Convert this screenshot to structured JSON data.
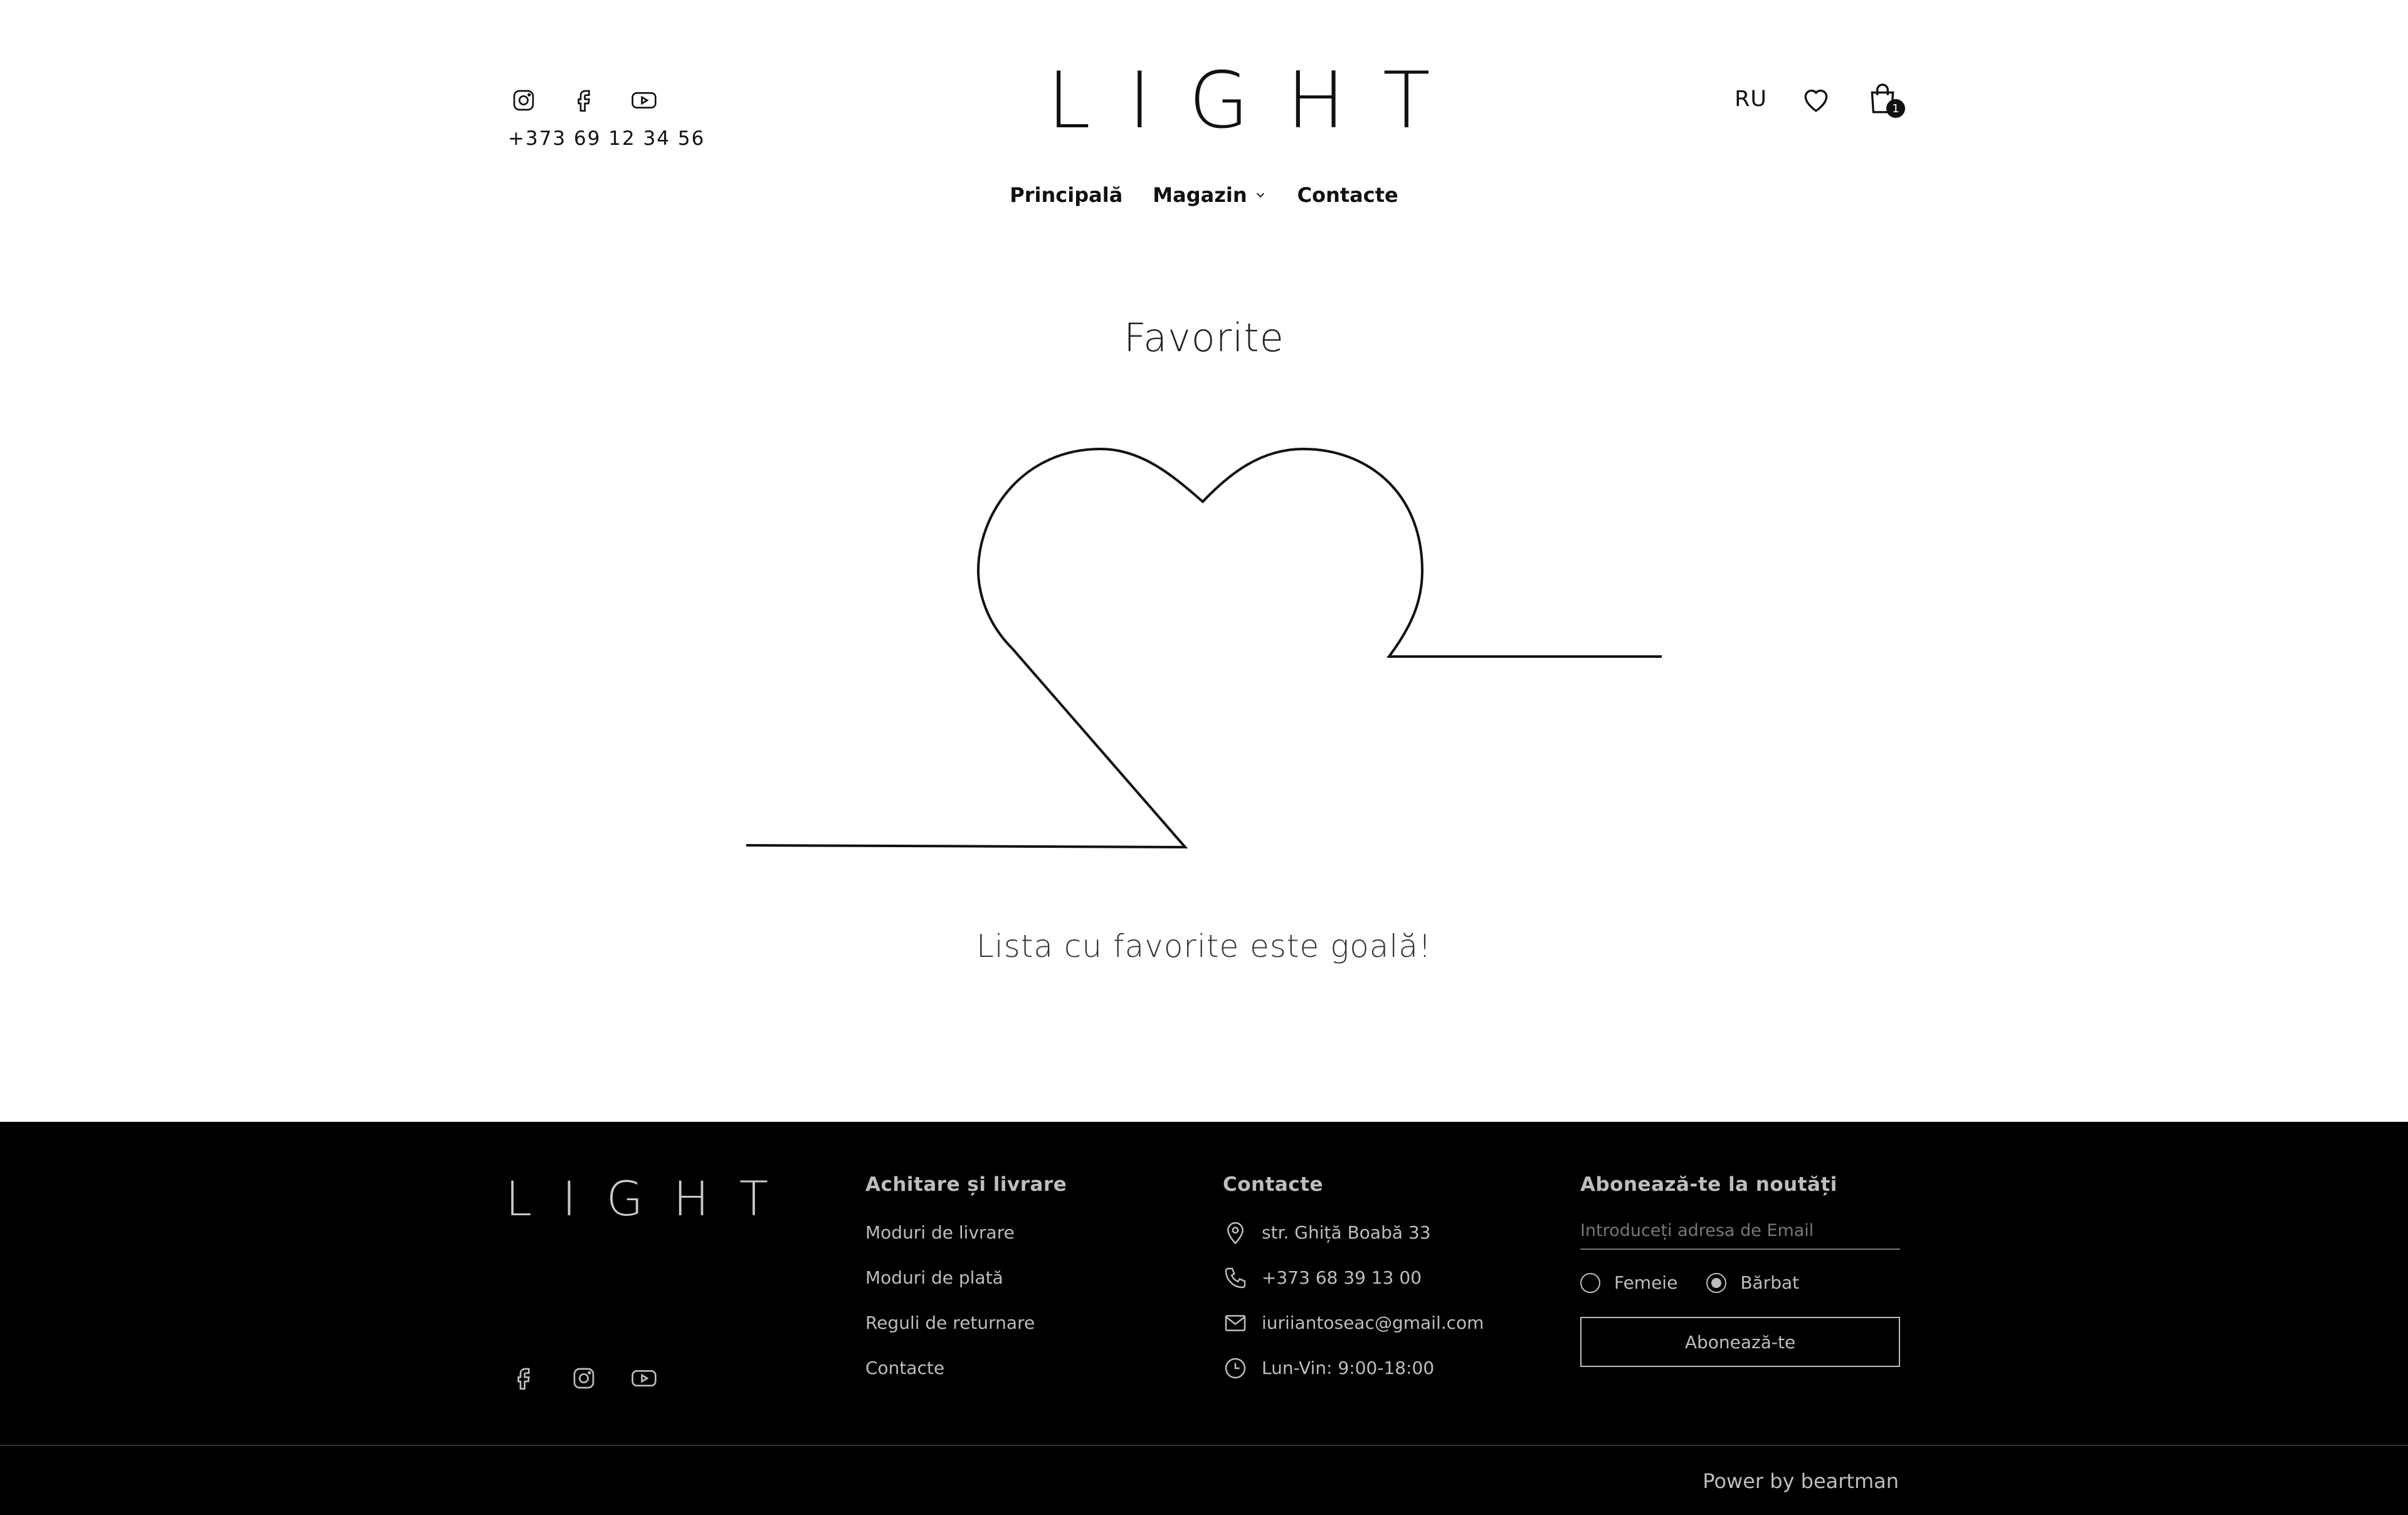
{
  "header": {
    "phone": "+373 69 12 34 56",
    "logo": "LIGHT",
    "language": "RU",
    "cart_count": "1",
    "social_icons": [
      "instagram-icon",
      "facebook-icon",
      "youtube-icon"
    ]
  },
  "nav": {
    "items": [
      "Principală",
      "Magazin",
      "Contacte"
    ]
  },
  "main": {
    "title": "Favorite",
    "empty_message": "Lista cu favorite este goală!"
  },
  "footer": {
    "logo": "LIGHT",
    "col1": {
      "title": "Achitare și livrare",
      "links": [
        "Moduri de livrare",
        "Moduri de plată",
        "Reguli de returnare",
        "Contacte"
      ]
    },
    "col2": {
      "title": "Contacte",
      "address": "str. Ghiță Boabă 33",
      "phone": "+373 68 39 13 00",
      "email": "iuriiantoseac@gmail.com",
      "hours": "Lun-Vin: 9:00-18:00"
    },
    "col3": {
      "title": "Abonează-te la noutăți",
      "email_placeholder": "Introduceți adresa de Email",
      "radio_female": "Femeie",
      "radio_male": "Bărbat",
      "selected": "Bărbat",
      "button": "Abonează-te"
    },
    "powered": "Power by beartman"
  }
}
